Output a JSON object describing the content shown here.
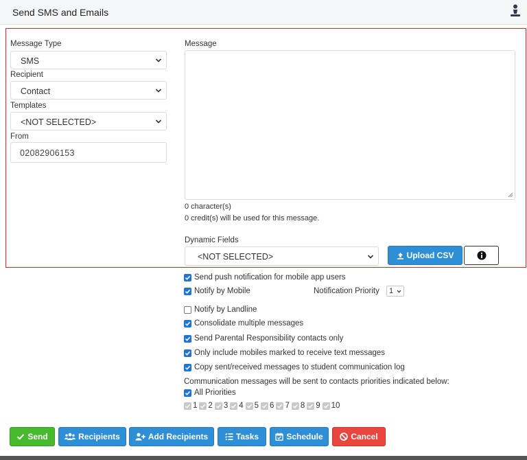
{
  "header": {
    "title": "Send SMS and Emails",
    "icon": "person-icon"
  },
  "form": {
    "message_type": {
      "label": "Message Type",
      "value": "SMS"
    },
    "recipient": {
      "label": "Recipient",
      "value": "Contact"
    },
    "templates": {
      "label": "Templates",
      "value": "<NOT SELECTED>"
    },
    "from": {
      "label": "From",
      "value": "02082906153"
    },
    "message": {
      "label": "Message",
      "value": ""
    },
    "char_count": "0 character(s)",
    "credit_info": "0 credit(s) will be used for this message.",
    "dynamic_fields": {
      "label": "Dynamic Fields",
      "value": "<NOT SELECTED>"
    },
    "upload_csv_label": "Upload CSV"
  },
  "options": {
    "push": {
      "label": "Send push notification for mobile app users",
      "checked": true
    },
    "mobile": {
      "label": "Notify by Mobile",
      "checked": true
    },
    "notification_priority": {
      "label": "Notification Priority",
      "value": "1"
    },
    "landline": {
      "label": "Notify by Landline",
      "checked": false
    },
    "consolidate": {
      "label": "Consolidate multiple messages",
      "checked": true
    },
    "parental": {
      "label": "Send Parental Responsibility contacts only",
      "checked": true
    },
    "only_mobiles": {
      "label": "Only include mobiles marked to receive text messages",
      "checked": true
    },
    "copy_log": {
      "label": "Copy sent/received messages to student communication log",
      "checked": true
    },
    "priorities_note": "Communication messages will be sent to contacts priorities indicated below:",
    "all_priorities": {
      "label": "All Priorities",
      "checked": true
    },
    "priorities": [
      "1",
      "2",
      "3",
      "4",
      "5",
      "6",
      "7",
      "8",
      "9",
      "10"
    ]
  },
  "actions": {
    "send": "Send",
    "recipients": "Recipients",
    "add_recipients": "Add Recipients",
    "tasks": "Tasks",
    "schedule": "Schedule",
    "cancel": "Cancel"
  },
  "colors": {
    "accent_blue": "#2f8fd6",
    "send_green": "#46b92c",
    "cancel_red": "#e9473d",
    "highlight_border": "#e02424",
    "checkbox_blue": "#1f73d8"
  }
}
